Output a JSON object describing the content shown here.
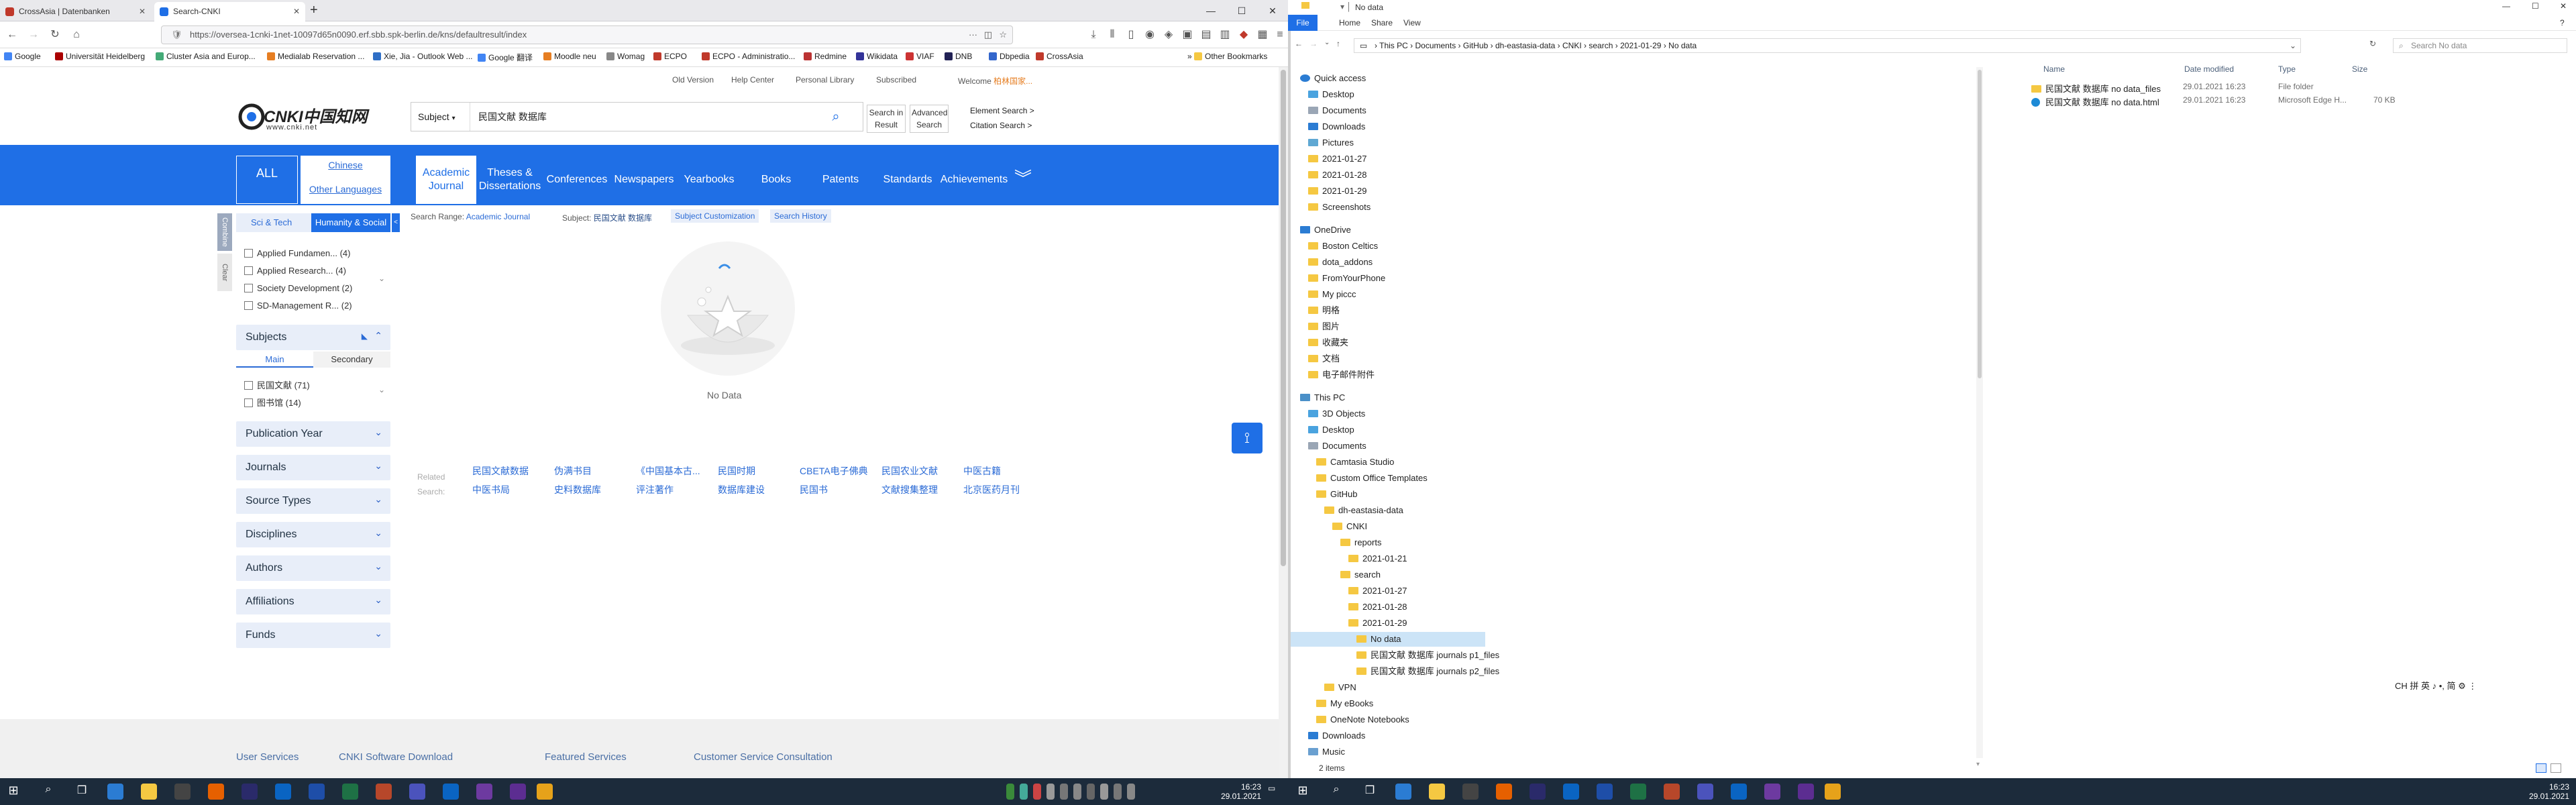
{
  "browser": {
    "tabs": [
      {
        "label": "CrossAsia | Datenbanken"
      },
      {
        "label": "Search-CNKI"
      }
    ],
    "url": "https://oversea-1cnki-1net-10097d65n0090.erf.sbb.spk-berlin.de/kns/defaultresult/index",
    "bookmarks": [
      "Google",
      "Universität Heidelberg",
      "Cluster Asia and Europ...",
      "Medialab Reservation ...",
      "Xie, Jia - Outlook Web ...",
      "Google 翻译",
      "Moodle neu",
      "Womag",
      "ECPO",
      "ECPO - Administratio...",
      "Redmine",
      "Wikidata",
      "VIAF",
      "DNB",
      "Dbpedia",
      "CrossAsia"
    ],
    "other_bookmarks": "Other Bookmarks"
  },
  "cnki": {
    "top_links": [
      "Old Version",
      "Help Center",
      "Personal Library",
      "Subscribed"
    ],
    "welcome": "Welcome",
    "welcome_user": "柏林国家...",
    "logo_text": "CNKI中国知网",
    "logo_url": "www.cnki.net",
    "search_field": "Subject",
    "search_query": "民国文献 数据库",
    "search_in_result": "Search in Result",
    "advanced_search": "Advanced Search",
    "element_search": "Element Search",
    "citation_search": "Citation Search",
    "nav_all": "ALL",
    "lang_chinese": "Chinese",
    "lang_other": "Other Languages",
    "nav": [
      "Academic Journal",
      "Theses & Dissertations",
      "Conferences",
      "Newspapers",
      "Yearbooks",
      "Books",
      "Patents",
      "Standards",
      "Achievements"
    ],
    "side_tabs": [
      "Sci & Tech",
      "Humanity & Social"
    ],
    "side_vertical": [
      "Combine",
      "Clear"
    ],
    "categories": [
      {
        "label": "Applied Fundamen...",
        "count": "(4)"
      },
      {
        "label": "Applied Research...",
        "count": "(4)"
      },
      {
        "label": "Society Development",
        "count": "(2)"
      },
      {
        "label": "SD-Management R...",
        "count": "(2)"
      }
    ],
    "subjects_title": "Subjects",
    "subject_tabs": [
      "Main",
      "Secondary"
    ],
    "subject_items": [
      {
        "label": "民国文献",
        "count": "(71)"
      },
      {
        "label": "图书馆",
        "count": "(14)"
      }
    ],
    "facets": [
      "Publication Year",
      "Journals",
      "Source Types",
      "Disciplines",
      "Authors",
      "Affiliations",
      "Funds"
    ],
    "search_range_label": "Search Range:",
    "search_range_value": "Academic Journal",
    "subject_label": "Subject:",
    "subject_value": "民国文献 数据库",
    "subject_customization": "Subject Customization",
    "search_history": "Search History",
    "no_data": "No Data",
    "related_label": "Related Search:",
    "related": [
      "民国文献数据",
      "伪满书目",
      "《中国基本古...",
      "民国时期",
      "CBETA电子佛典",
      "民国农业文献",
      "中医古籍",
      "中医书局",
      "史料数据库",
      "评注著作",
      "数据库建设",
      "民国书",
      "文献搜集整理",
      "北京医药月刊"
    ],
    "footer": [
      "User Services",
      "CNKI Software Download",
      "Featured Services",
      "Customer Service Consultation"
    ]
  },
  "explorer": {
    "title": "No data",
    "ribbon": [
      "File",
      "Home",
      "Share",
      "View"
    ],
    "breadcrumb": [
      "This PC",
      "Documents",
      "GitHub",
      "dh-eastasia-data",
      "CNKI",
      "search",
      "2021-01-29",
      "No data"
    ],
    "search_placeholder": "Search No data",
    "tree": [
      {
        "label": "Quick access",
        "indent": 0,
        "icon": "star"
      },
      {
        "label": "Desktop",
        "indent": 1,
        "icon": "folder-blue"
      },
      {
        "label": "Documents",
        "indent": 1,
        "icon": "doc"
      },
      {
        "label": "Downloads",
        "indent": 1,
        "icon": "download"
      },
      {
        "label": "Pictures",
        "indent": 1,
        "icon": "pic"
      },
      {
        "label": "2021-01-27",
        "indent": 1,
        "icon": "folder"
      },
      {
        "label": "2021-01-28",
        "indent": 1,
        "icon": "folder"
      },
      {
        "label": "2021-01-29",
        "indent": 1,
        "icon": "folder"
      },
      {
        "label": "Screenshots",
        "indent": 1,
        "icon": "folder"
      },
      {
        "label": "",
        "indent": 0,
        "icon": "none"
      },
      {
        "label": "OneDrive",
        "indent": 0,
        "icon": "cloud"
      },
      {
        "label": "Boston Celtics",
        "indent": 1,
        "icon": "folder"
      },
      {
        "label": "dota_addons",
        "indent": 1,
        "icon": "folder"
      },
      {
        "label": "FromYourPhone",
        "indent": 1,
        "icon": "folder"
      },
      {
        "label": "My piccc",
        "indent": 1,
        "icon": "folder"
      },
      {
        "label": "明格",
        "indent": 1,
        "icon": "folder"
      },
      {
        "label": "图片",
        "indent": 1,
        "icon": "folder"
      },
      {
        "label": "收藏夹",
        "indent": 1,
        "icon": "folder"
      },
      {
        "label": "文档",
        "indent": 1,
        "icon": "folder"
      },
      {
        "label": "电子邮件附件",
        "indent": 1,
        "icon": "folder"
      },
      {
        "label": "",
        "indent": 0,
        "icon": "none"
      },
      {
        "label": "This PC",
        "indent": 0,
        "icon": "pc"
      },
      {
        "label": "3D Objects",
        "indent": 1,
        "icon": "folder-blue"
      },
      {
        "label": "Desktop",
        "indent": 1,
        "icon": "folder-blue"
      },
      {
        "label": "Documents",
        "indent": 1,
        "icon": "doc"
      },
      {
        "label": "Camtasia Studio",
        "indent": 2,
        "icon": "folder"
      },
      {
        "label": "Custom Office Templates",
        "indent": 2,
        "icon": "folder"
      },
      {
        "label": "GitHub",
        "indent": 2,
        "icon": "folder"
      },
      {
        "label": "dh-eastasia-data",
        "indent": 3,
        "icon": "folder"
      },
      {
        "label": "CNKI",
        "indent": 4,
        "icon": "folder"
      },
      {
        "label": "reports",
        "indent": 5,
        "icon": "folder"
      },
      {
        "label": "2021-01-21",
        "indent": 6,
        "icon": "folder"
      },
      {
        "label": "search",
        "indent": 5,
        "icon": "folder"
      },
      {
        "label": "2021-01-27",
        "indent": 6,
        "icon": "folder"
      },
      {
        "label": "2021-01-28",
        "indent": 6,
        "icon": "folder"
      },
      {
        "label": "2021-01-29",
        "indent": 6,
        "icon": "folder"
      },
      {
        "label": "No data",
        "indent": 7,
        "icon": "folder",
        "selected": true
      },
      {
        "label": "民国文献 数据库 journals p1_files",
        "indent": 7,
        "icon": "folder"
      },
      {
        "label": "民国文献 数据库 journals p2_files",
        "indent": 7,
        "icon": "folder"
      },
      {
        "label": "VPN",
        "indent": 3,
        "icon": "folder"
      },
      {
        "label": "My eBooks",
        "indent": 2,
        "icon": "folder"
      },
      {
        "label": "OneNote Notebooks",
        "indent": 2,
        "icon": "folder"
      },
      {
        "label": "Downloads",
        "indent": 1,
        "icon": "download"
      },
      {
        "label": "Music",
        "indent": 1,
        "icon": "music"
      }
    ],
    "columns": [
      "Name",
      "Date modified",
      "Type",
      "Size"
    ],
    "files": [
      {
        "name": "民国文献 数据库 no data_files",
        "date": "29.01.2021 16:23",
        "type": "File folder",
        "size": "",
        "icon": "folder"
      },
      {
        "name": "民国文献 数据库 no data.html",
        "date": "29.01.2021 16:23",
        "type": "Microsoft Edge H...",
        "size": "70 KB",
        "icon": "edge"
      }
    ],
    "status": "2 items"
  },
  "ime": "CH 拼 英 ♪ •, 简 ⚙ ⋮",
  "taskbar": {
    "left_time": "16:23",
    "left_date": "29.01.2021",
    "right_time": "16:23",
    "right_date": "29.01.2021"
  },
  "colors": {
    "cnki_blue": "#1f6fe6",
    "taskbar": "#1c2b3b",
    "folder": "#f5c842"
  }
}
